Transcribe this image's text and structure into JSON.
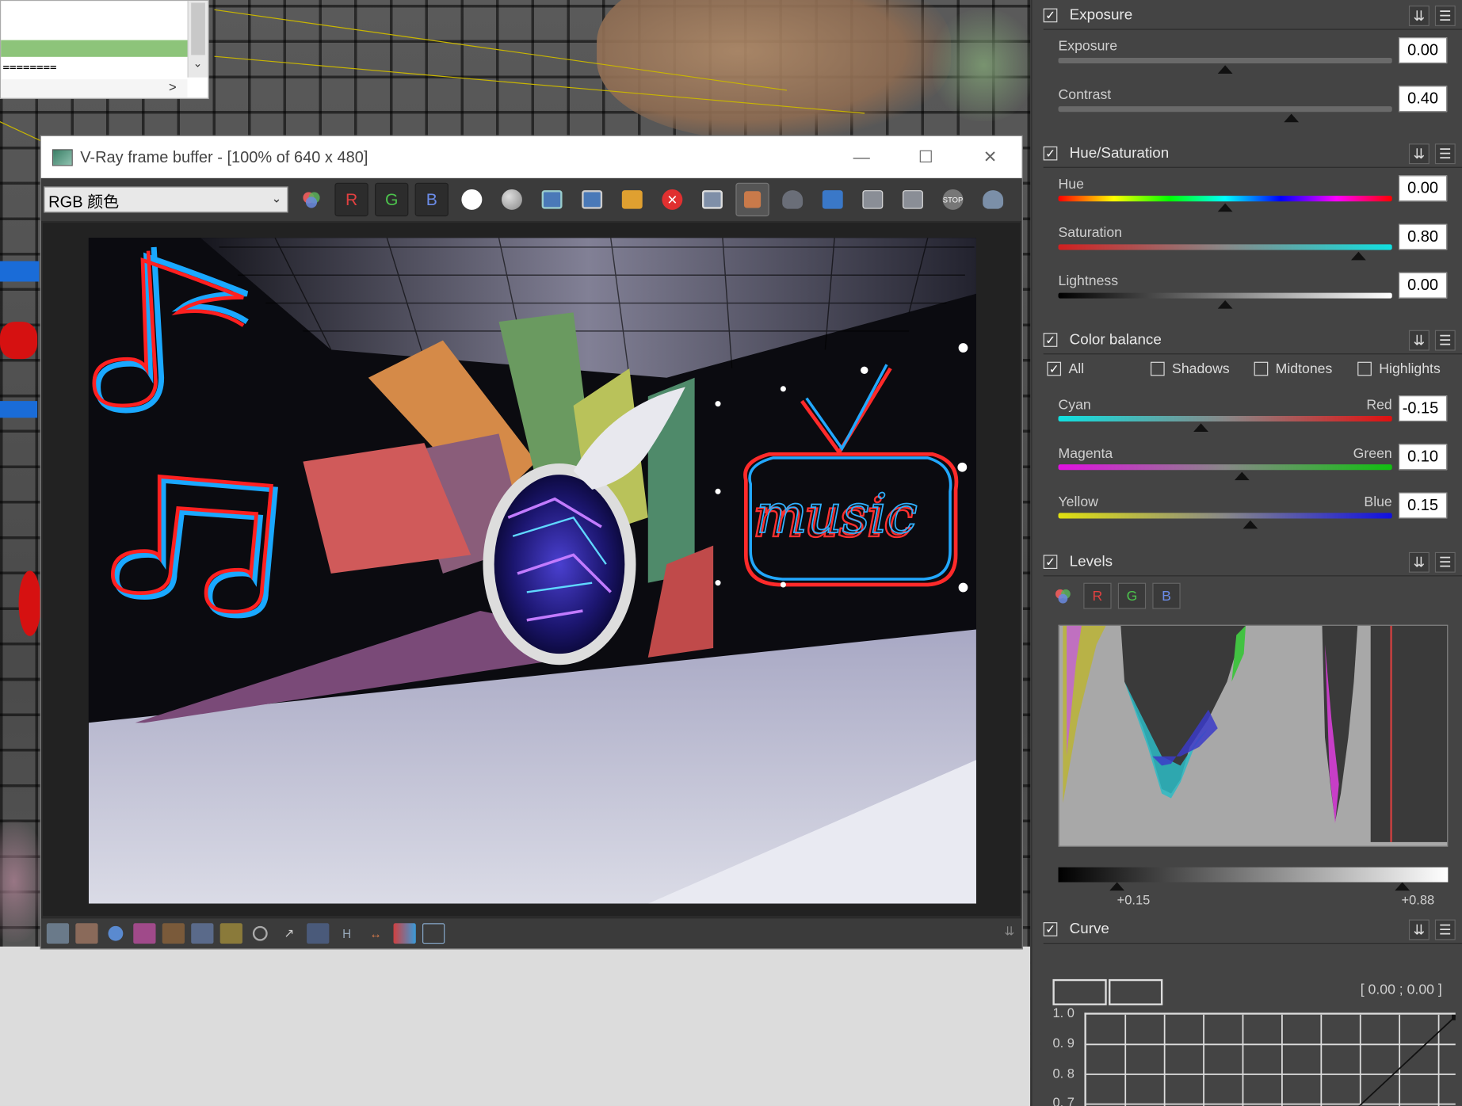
{
  "colors": {
    "accent_green": "#8dc47a",
    "panel_bg": "#444444",
    "vfb_bg": "#2b2b2b"
  },
  "mini_list": {
    "eq_line": "========",
    "arrow_right": ">",
    "arrow_down": "⌄"
  },
  "vfb": {
    "title": "V-Ray frame buffer - [100% of 640 x 480]",
    "channel": "RGB 颜色",
    "tools": [
      "color-icon",
      "R",
      "G",
      "B",
      "white-circle-icon",
      "gray-circle-icon",
      "save-icon",
      "save-all-icon",
      "open-icon",
      "clear-icon",
      "region-icon",
      "track-mouse-icon",
      "teapot-icon",
      "compare-icon",
      "ab-icon",
      "ab-vert-icon",
      "stop-icon",
      "render-teapot-icon"
    ],
    "bottom_tools": [
      "H"
    ],
    "render": {
      "text_music": "music"
    }
  },
  "panel": {
    "exposure": {
      "title": "Exposure",
      "exposure_label": "Exposure",
      "exposure_value": "0.00",
      "exposure_frac": 0.5,
      "contrast_label": "Contrast",
      "contrast_value": "0.40",
      "contrast_frac": 0.7
    },
    "hue_sat": {
      "title": "Hue/Saturation",
      "hue_label": "Hue",
      "hue_value": "0.00",
      "hue_frac": 0.5,
      "sat_label": "Saturation",
      "sat_value": "0.80",
      "sat_frac": 0.9,
      "light_label": "Lightness",
      "light_value": "0.00",
      "light_frac": 0.5
    },
    "color_balance": {
      "title": "Color balance",
      "opt_all": "All",
      "opt_shadows": "Shadows",
      "opt_midtones": "Midtones",
      "opt_highlights": "Highlights",
      "cyan": "Cyan",
      "red": "Red",
      "cr_value": "-0.15",
      "cr_frac": 0.43,
      "magenta": "Magenta",
      "green": "Green",
      "mg_value": "0.10",
      "mg_frac": 0.55,
      "yellow": "Yellow",
      "blue": "Blue",
      "yb_value": "0.15",
      "yb_frac": 0.575
    },
    "levels": {
      "title": "Levels",
      "btn_r": "R",
      "btn_g": "G",
      "btn_b": "B",
      "low_label": "+0.15",
      "high_label": "+0.88",
      "low_frac": 0.15,
      "high_frac": 0.88
    },
    "curve": {
      "title": "Curve",
      "coord": "[ 0.00 ; 0.00 ]",
      "ticks": [
        "1. 0",
        "0. 9",
        "0. 8",
        "0. 7"
      ]
    }
  }
}
